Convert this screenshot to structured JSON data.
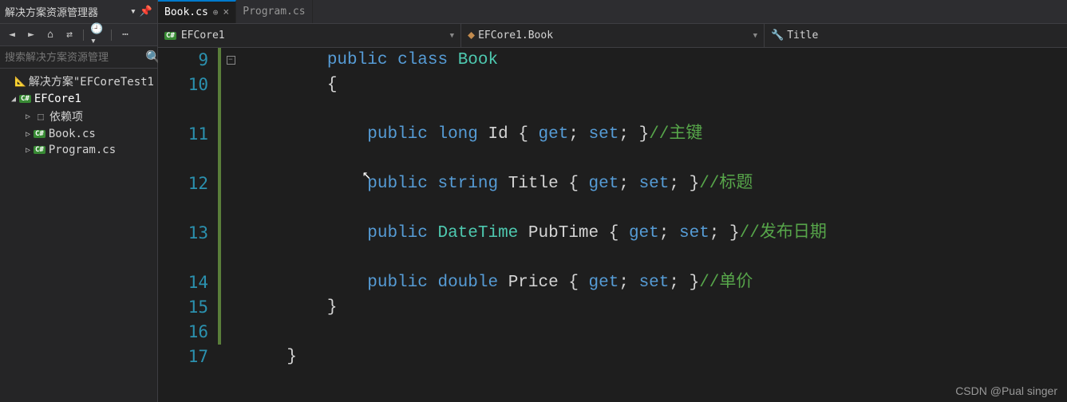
{
  "sidebar": {
    "title": "解决方案资源管理器",
    "search_placeholder": "搜索解决方案资源管理",
    "solution": "解决方案\"EFCoreTest1",
    "project": "EFCore1",
    "items": [
      {
        "label": "依赖项",
        "icon": "deps"
      },
      {
        "label": "Book.cs",
        "icon": "cs"
      },
      {
        "label": "Program.cs",
        "icon": "cs"
      }
    ]
  },
  "tabs": [
    {
      "label": "Book.cs",
      "active": true
    },
    {
      "label": "Program.cs",
      "active": false
    }
  ],
  "nav": {
    "project": "EFCore1",
    "class": "EFCore1.Book",
    "member": "Title"
  },
  "code": {
    "lines": [
      {
        "n": 9,
        "indent": 2,
        "tokens": [
          [
            "kw",
            "public"
          ],
          [
            "sp",
            " "
          ],
          [
            "kw",
            "class"
          ],
          [
            "sp",
            " "
          ],
          [
            "cls",
            "Book"
          ]
        ]
      },
      {
        "n": 10,
        "indent": 2,
        "tokens": [
          [
            "punct",
            "{"
          ]
        ]
      },
      {
        "n": 11,
        "indent": 3,
        "tokens": [
          [
            "kw",
            "public"
          ],
          [
            "sp",
            " "
          ],
          [
            "kw",
            "long"
          ],
          [
            "sp",
            " "
          ],
          [
            "prop",
            "Id"
          ],
          [
            "sp",
            " "
          ],
          [
            "punct",
            "{ "
          ],
          [
            "kw",
            "get"
          ],
          [
            "punct",
            "; "
          ],
          [
            "kw",
            "set"
          ],
          [
            "punct",
            "; }"
          ],
          [
            "comment",
            "//主键"
          ]
        ]
      },
      {
        "n": 12,
        "indent": 3,
        "tokens": [
          [
            "kw",
            "public"
          ],
          [
            "sp",
            " "
          ],
          [
            "kw",
            "string"
          ],
          [
            "sp",
            " "
          ],
          [
            "prop",
            "Title"
          ],
          [
            "sp",
            " "
          ],
          [
            "punct",
            "{ "
          ],
          [
            "kw",
            "get"
          ],
          [
            "punct",
            "; "
          ],
          [
            "kw",
            "set"
          ],
          [
            "punct",
            "; }"
          ],
          [
            "comment",
            "//标题"
          ]
        ]
      },
      {
        "n": 13,
        "indent": 3,
        "tokens": [
          [
            "kw",
            "public"
          ],
          [
            "sp",
            " "
          ],
          [
            "type",
            "DateTime"
          ],
          [
            "sp",
            " "
          ],
          [
            "prop",
            "PubTime"
          ],
          [
            "sp",
            " "
          ],
          [
            "punct",
            "{ "
          ],
          [
            "kw",
            "get"
          ],
          [
            "punct",
            "; "
          ],
          [
            "kw",
            "set"
          ],
          [
            "punct",
            "; }"
          ],
          [
            "comment",
            "//发布日期"
          ]
        ]
      },
      {
        "n": 14,
        "indent": 3,
        "tokens": [
          [
            "kw",
            "public"
          ],
          [
            "sp",
            " "
          ],
          [
            "kw",
            "double"
          ],
          [
            "sp",
            " "
          ],
          [
            "prop",
            "Price"
          ],
          [
            "sp",
            " "
          ],
          [
            "punct",
            "{ "
          ],
          [
            "kw",
            "get"
          ],
          [
            "punct",
            "; "
          ],
          [
            "kw",
            "set"
          ],
          [
            "punct",
            "; }"
          ],
          [
            "comment",
            "//单价"
          ]
        ]
      },
      {
        "n": 15,
        "indent": 2,
        "tokens": [
          [
            "punct",
            "}"
          ]
        ]
      },
      {
        "n": 16,
        "indent": 1,
        "tokens": []
      },
      {
        "n": 17,
        "indent": 1,
        "tokens": [
          [
            "punct",
            "}"
          ]
        ]
      }
    ],
    "blank_after": [
      10,
      11,
      12,
      13
    ]
  },
  "watermark": "CSDN @Pual singer"
}
